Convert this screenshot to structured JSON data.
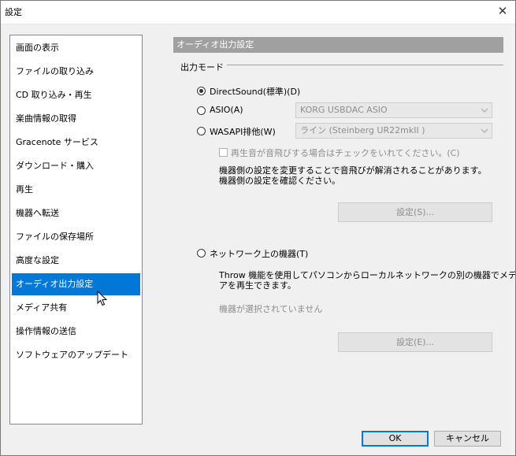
{
  "window": {
    "title": "設定",
    "close_icon": "close-icon"
  },
  "sidebar": {
    "items": [
      {
        "label": "画面の表示"
      },
      {
        "label": "ファイルの取り込み"
      },
      {
        "label": "CD 取り込み・再生"
      },
      {
        "label": "楽曲情報の取得"
      },
      {
        "label": "Gracenote サービス"
      },
      {
        "label": "ダウンロード・購入"
      },
      {
        "label": "再生"
      },
      {
        "label": "機器へ転送"
      },
      {
        "label": "ファイルの保存場所"
      },
      {
        "label": "高度な設定"
      },
      {
        "label": "オーディオ出力設定",
        "selected": true
      },
      {
        "label": "メディア共有"
      },
      {
        "label": "操作情報の送信"
      },
      {
        "label": "ソフトウェアのアップデート"
      }
    ],
    "selected_color": "#0078d7"
  },
  "panel": {
    "header": "オーディオ出力設定",
    "output_mode_group": "出力モード",
    "radio_directsound": "DirectSound(標準)(D)",
    "radio_asio": "ASIO(A)",
    "asio_device": "KORG USBDAC ASIO",
    "radio_wasapi": "WASAPI排他(W)",
    "wasapi_device": "ライン (Steinberg UR22mkII )",
    "checkbox_label": "再生音が音飛びする場合はチェックをいれてください。(C)",
    "note_line1": "機器側の設定を変更することで音飛びが解消されることがあります。",
    "note_line2": "機器側の設定を確認ください。",
    "settings_button_1": "設定(S)...",
    "radio_network": "ネットワーク上の機器(T)",
    "network_desc_line1": "Throw 機能を使用してパソコンからローカルネットワークの別の機器でメディ",
    "network_desc_line2": "アを再生できます。",
    "no_device_selected": "機器が選択されていません",
    "settings_button_2": "設定(E)...",
    "selected_mode": "DirectSound(標準)(D)"
  },
  "footer": {
    "ok_label": "OK",
    "cancel_label": "キャンセル"
  },
  "colors": {
    "header_bg": "#a0a0a0",
    "disabled_text": "#8d8d8d",
    "accent": "#0078d7"
  }
}
